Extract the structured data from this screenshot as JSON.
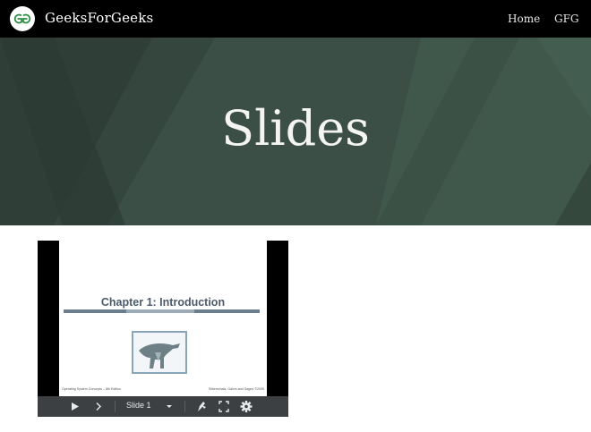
{
  "navbar": {
    "brand": "GeeksForGeeks",
    "links": [
      {
        "label": "Home"
      },
      {
        "label": "GFG"
      }
    ]
  },
  "hero": {
    "title": "Slides"
  },
  "embed": {
    "slide": {
      "title": "Chapter 1:  Introduction",
      "footer_left": "Operating System Concepts – 8th Edition",
      "footer_right": "Silberschatz, Galvin and Gagne ©2009"
    },
    "controls": {
      "slide_selector": "Slide 1"
    }
  },
  "colors": {
    "navbar_bg": "#000000",
    "hero_bg": "#3a4e45",
    "controls_bg": "#3c4043",
    "slide_title": "#4b5b6b"
  }
}
